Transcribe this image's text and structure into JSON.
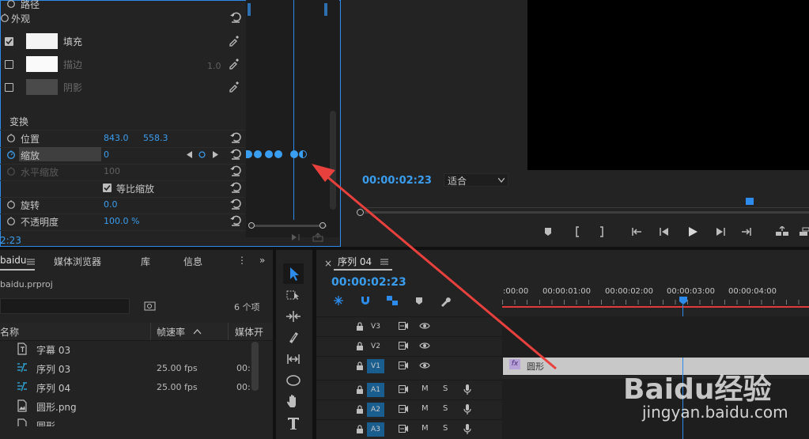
{
  "effect_controls": {
    "section_path": "路径",
    "section_appearance": "外观",
    "fill_label": "填充",
    "stroke_label": "描边",
    "stroke_value": "1.0",
    "shadow_label": "阴影",
    "transform_label": "变换",
    "position_label": "位置",
    "position_x": "843.0",
    "position_y": "558.3",
    "scale_label": "缩放",
    "scale_value": "0",
    "h_scale_label": "水平缩放",
    "h_scale_value": "100",
    "uniform_scale_label": "等比缩放",
    "rotation_label": "旋转",
    "rotation_value": "0.0",
    "opacity_label": "不透明度",
    "opacity_value": "100.0 %",
    "timecode": "2:23"
  },
  "program": {
    "timecode": "00:00:02:23",
    "fit_label": "适合"
  },
  "project": {
    "tab_name": "baidu",
    "tab_media": "媒体浏览器",
    "tab_library": "库",
    "tab_info": "信息",
    "project_file": "baidu.prproj",
    "item_count": "6 个项",
    "col_name": "名称",
    "col_fps": "帧速率",
    "col_media": "媒体开",
    "items": [
      {
        "name": "字幕 03",
        "fps": "",
        "start": ""
      },
      {
        "name": "序列 03",
        "fps": "25.00 fps",
        "start": "00:"
      },
      {
        "name": "序列 04",
        "fps": "25.00 fps",
        "start": "00:"
      },
      {
        "name": "圆形.png",
        "fps": "",
        "start": ""
      },
      {
        "name": "圆形",
        "fps": "",
        "start": ""
      }
    ]
  },
  "timeline": {
    "sequence_name": "序列 04",
    "timecode": "00:00:02:23",
    "ruler": [
      ":00:00",
      "00:00:01:00",
      "00:00:02:00",
      "00:00:03:00",
      "00:00:04:00"
    ],
    "tracks": [
      {
        "name": "V3",
        "type": "video",
        "active": false
      },
      {
        "name": "V2",
        "type": "video",
        "active": false
      },
      {
        "name": "V1",
        "type": "video",
        "active": true
      },
      {
        "name": "A1",
        "type": "audio",
        "active": true
      },
      {
        "name": "A2",
        "type": "audio",
        "active": true
      },
      {
        "name": "A3",
        "type": "audio",
        "active": true
      }
    ],
    "mute_label": "M",
    "solo_label": "S",
    "clip_fx": "fx",
    "clip_name": "圆形"
  },
  "watermark": {
    "logo_text": "Baidu经验",
    "url": "jingyan.baidu.com"
  },
  "colors": {
    "accent": "#2d8ceb",
    "timecode": "#3a9ef0",
    "playhead_line": "#e03a3a",
    "arrow": "#e8403c"
  }
}
